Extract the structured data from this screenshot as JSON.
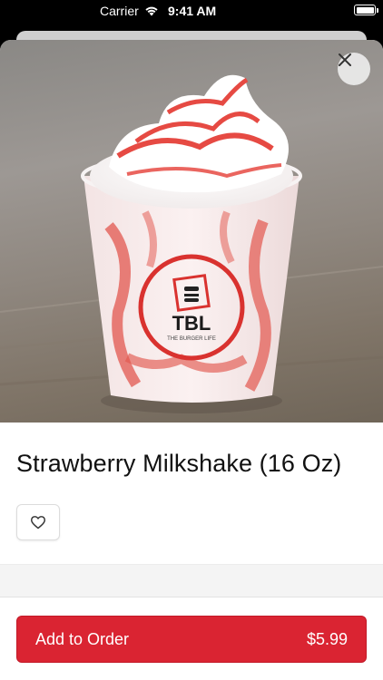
{
  "status_bar": {
    "carrier": "Carrier",
    "time": "9:41 AM"
  },
  "product": {
    "name": "Strawberry Milkshake (16 Oz)",
    "cup_logo_text": "TBL",
    "cup_logo_subtext": "THE BURGER LIFE"
  },
  "actions": {
    "add_label": "Add to Order",
    "price": "$5.99"
  },
  "colors": {
    "accent": "#da2432",
    "background": "#ffffff"
  },
  "icons": {
    "close": "close-icon",
    "favorite": "heart-outline-icon",
    "wifi": "wifi-icon",
    "battery": "battery-icon"
  }
}
